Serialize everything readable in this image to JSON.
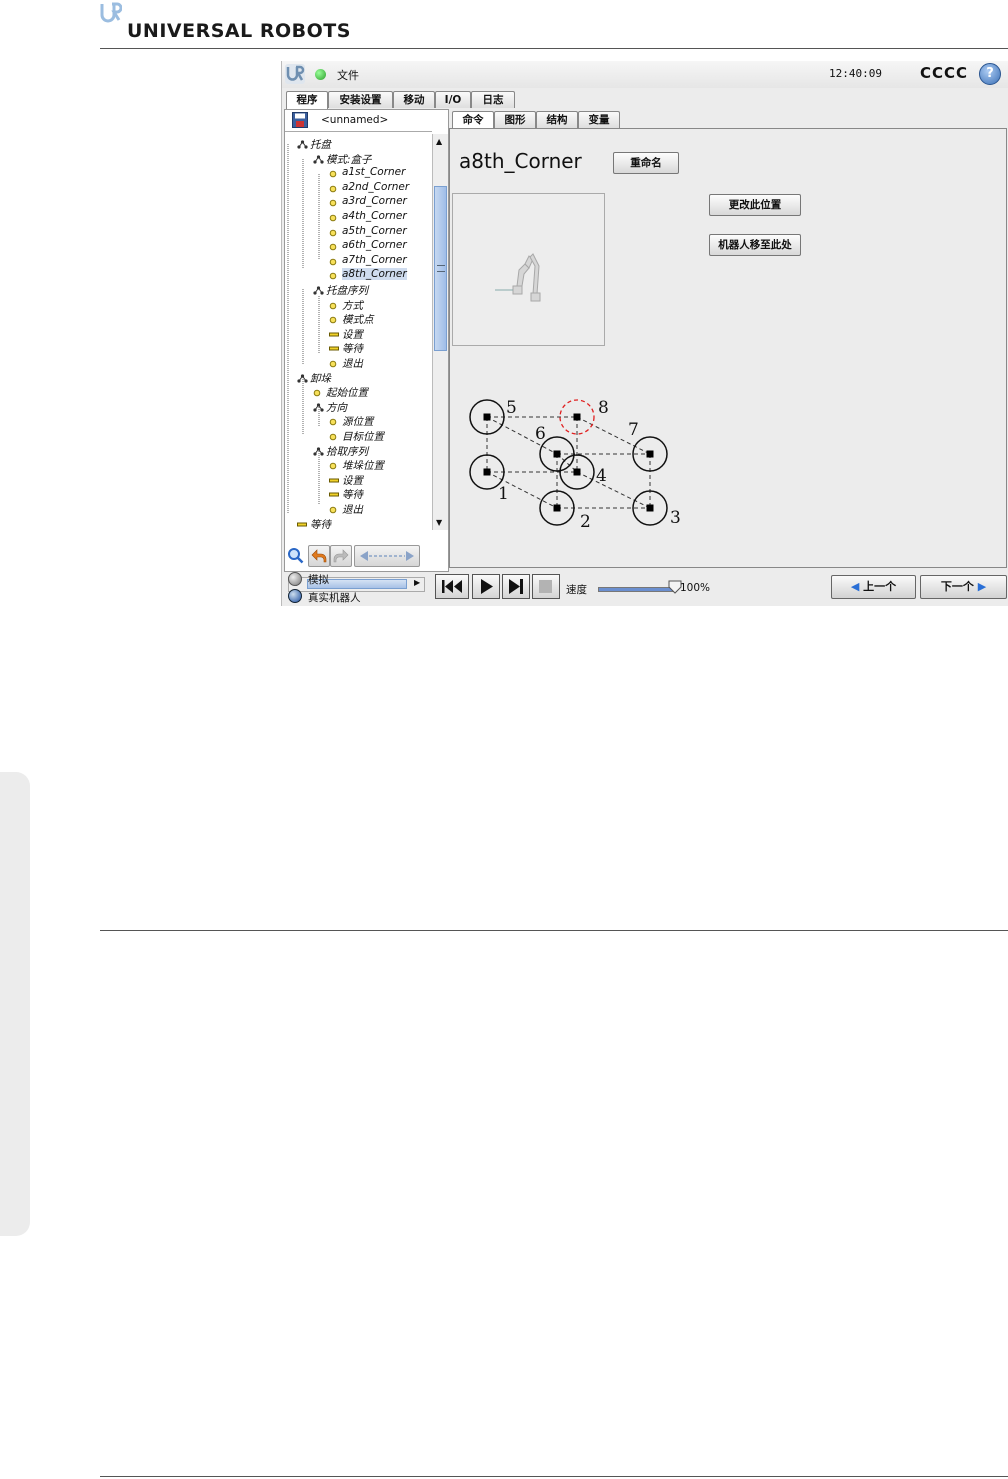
{
  "brand": {
    "name": "UNIVERSAL ROBOTS"
  },
  "topbar": {
    "file_menu": "文件",
    "clock": "12:40:09",
    "robot_name": "CCCC",
    "help_label": "?",
    "status_color": "#2a9d2a"
  },
  "main_tabs": [
    {
      "label": "程序",
      "active": true
    },
    {
      "label": "安装设置",
      "active": false
    },
    {
      "label": "移动",
      "active": false
    },
    {
      "label": "I/O",
      "active": false
    },
    {
      "label": "日志",
      "active": false
    }
  ],
  "program": {
    "name": "<unnamed>"
  },
  "tree": [
    {
      "label": "托盘",
      "icon": "pallet-icon"
    },
    {
      "label": "模式:盒子",
      "icon": "pattern-icon"
    },
    {
      "label": "a1st_Corner",
      "icon": "waypoint-icon"
    },
    {
      "label": "a2nd_Corner",
      "icon": "waypoint-icon"
    },
    {
      "label": "a3rd_Corner",
      "icon": "waypoint-icon"
    },
    {
      "label": "a4th_Corner",
      "icon": "waypoint-icon"
    },
    {
      "label": "a5th_Corner",
      "icon": "waypoint-icon"
    },
    {
      "label": "a6th_Corner",
      "icon": "waypoint-icon"
    },
    {
      "label": "a7th_Corner",
      "icon": "waypoint-icon"
    },
    {
      "label": "a8th_Corner",
      "icon": "waypoint-icon",
      "selected": true
    },
    {
      "label": "托盘序列",
      "icon": "sequence-icon"
    },
    {
      "label": "方式",
      "icon": "waypoint-icon"
    },
    {
      "label": "模式点",
      "icon": "waypoint-icon"
    },
    {
      "label": "设置",
      "icon": "set-icon"
    },
    {
      "label": "等待",
      "icon": "wait-icon"
    },
    {
      "label": "退出",
      "icon": "waypoint-icon"
    },
    {
      "label": "卸垛",
      "icon": "pallet-icon"
    },
    {
      "label": "起始位置",
      "icon": "waypoint-icon"
    },
    {
      "label": "方向",
      "icon": "direction-icon"
    },
    {
      "label": "源位置",
      "icon": "waypoint-icon"
    },
    {
      "label": "目标位置",
      "icon": "waypoint-icon"
    },
    {
      "label": "拾取序列",
      "icon": "sequence-icon"
    },
    {
      "label": "堆垛位置",
      "icon": "waypoint-icon"
    },
    {
      "label": "设置",
      "icon": "set-icon"
    },
    {
      "label": "等待",
      "icon": "wait-icon"
    },
    {
      "label": "退出",
      "icon": "waypoint-icon"
    },
    {
      "label": "等待",
      "icon": "wait-icon"
    }
  ],
  "right_tabs": [
    {
      "label": "命令",
      "active": true
    },
    {
      "label": "图形",
      "active": false
    },
    {
      "label": "结构",
      "active": false
    },
    {
      "label": "变量",
      "active": false
    }
  ],
  "command": {
    "node_title": "a8th_Corner",
    "rename_label": "重命名",
    "change_position_label": "更改此位置",
    "move_here_label": "机器人移至此处"
  },
  "pattern_labels": [
    "1",
    "2",
    "3",
    "4",
    "5",
    "6",
    "7",
    "8"
  ],
  "pattern_highlight": "8",
  "highlight_color": "#e02020",
  "bottom": {
    "simulation_label": "模拟",
    "real_robot_label": "真实机器人",
    "speed_label": "速度",
    "speed_value": "100%",
    "speed_fraction": 1.0,
    "prev_label": "上一个",
    "next_label": "下一个"
  }
}
